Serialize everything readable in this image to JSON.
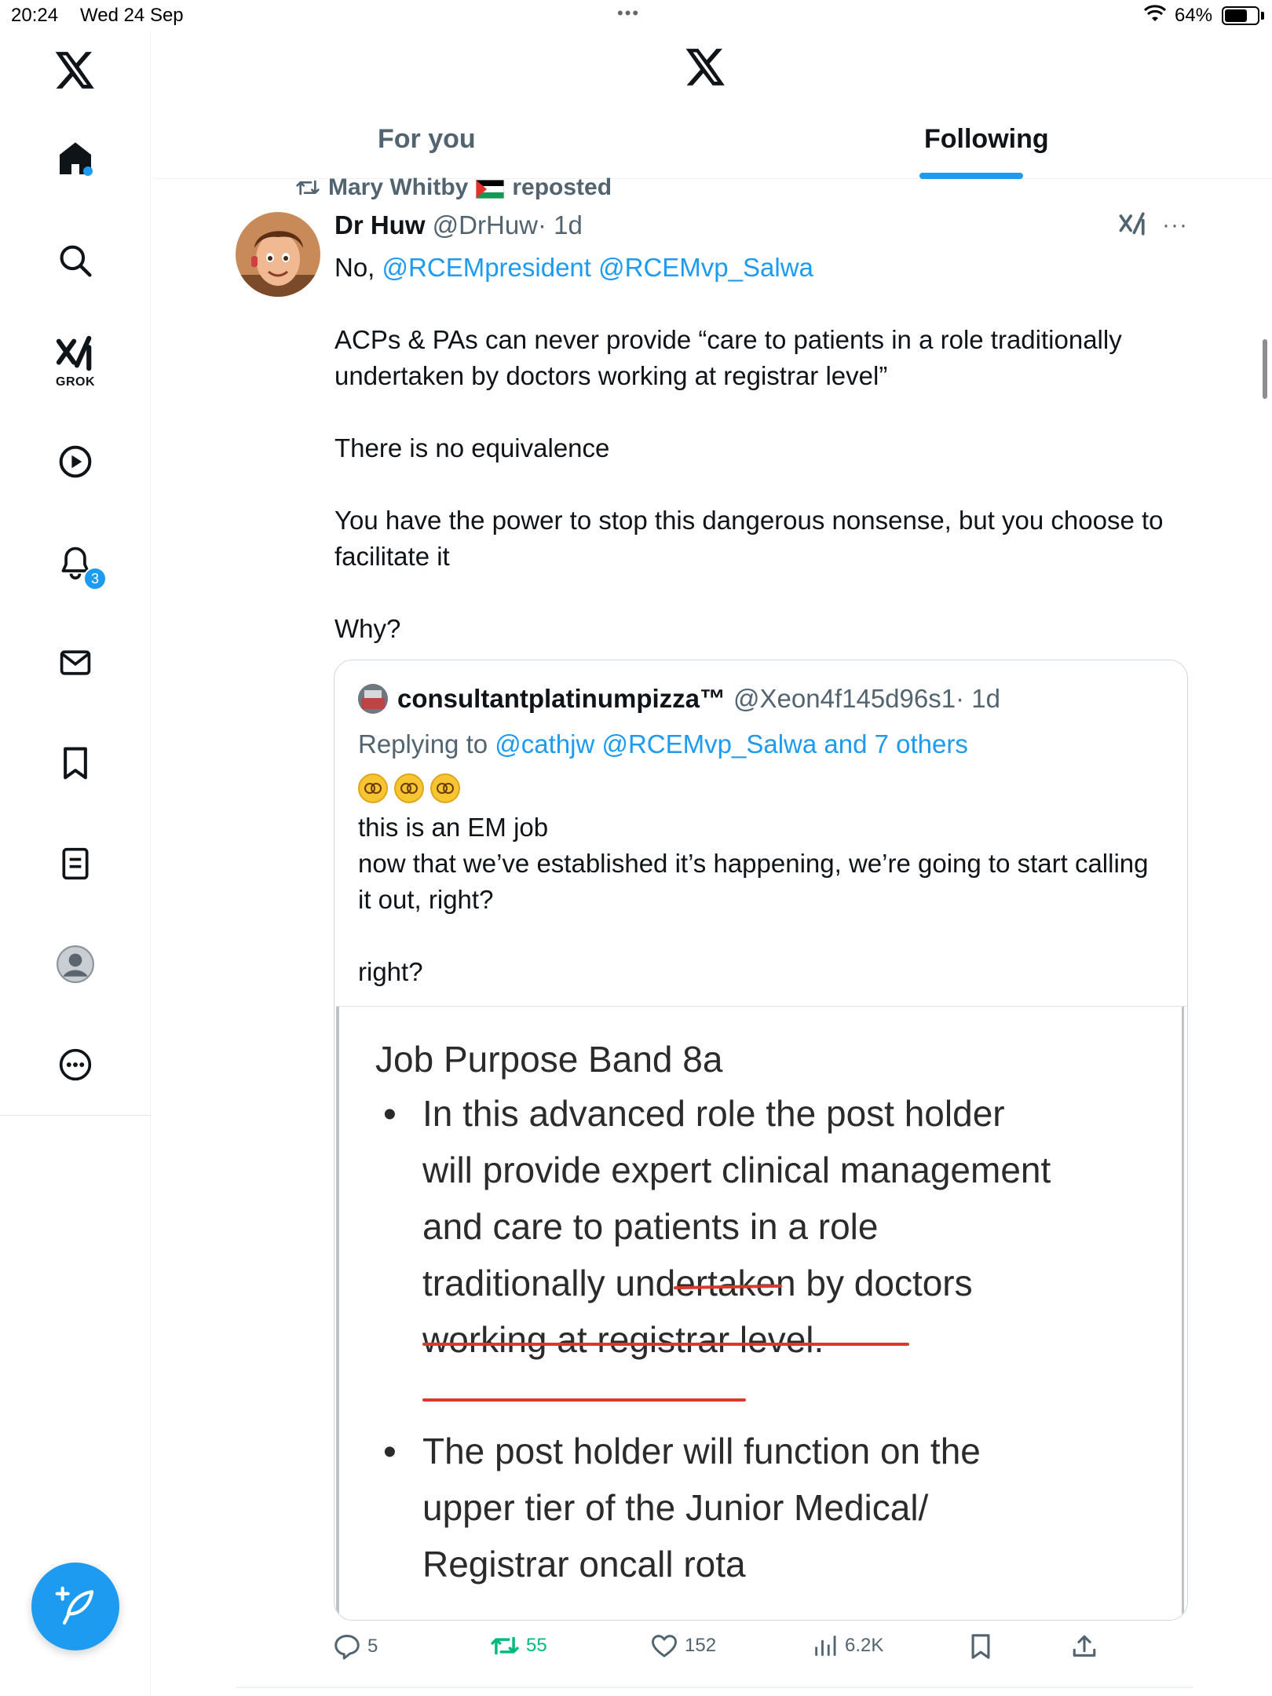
{
  "status_bar": {
    "time": "20:24",
    "date": "Wed 24 Sep",
    "battery": "64%"
  },
  "sidebar": {
    "grok_label": "GROK",
    "notifications_count": "3"
  },
  "header": {
    "tabs": [
      {
        "label": "For you",
        "active": false
      },
      {
        "label": "Following",
        "active": true
      }
    ]
  },
  "tweet": {
    "repost_label": "Mary Whitby",
    "repost_suffix": "reposted",
    "author_name": "Dr Huw",
    "author_handle": "@DrHuw",
    "time": "· 1d",
    "line1_prefix": "No, ",
    "mention1": "@RCEMpresident",
    "mention2": "@RCEMvp_Salwa",
    "para1": "ACPs & PAs can never provide “care to patients in a role traditionally undertaken by doctors working at registrar level”",
    "para2": "There is no equivalence",
    "para3": "You have the power to stop this dangerous nonsense, but you choose to facilitate it",
    "para4": "Why?",
    "stats": {
      "replies": "5",
      "reposts": "55",
      "likes": "152",
      "views": "6.2K"
    }
  },
  "quote": {
    "author_name": "consultantplatinumpizza™",
    "author_handle": "@Xeon4f145d96s1",
    "time": "· 1d",
    "replying_prefix": "Replying to ",
    "replying_mentions": "@cathjw @RCEMvp_Salwa and 7 others",
    "line1": "this is an EM job",
    "line2": "now that we’ve established it’s happening, we’re going to start calling it out, right?",
    "line3": "right?",
    "image": {
      "title": "Job Purpose Band 8a",
      "bullet1_l1": "In this advanced role the post holder",
      "bullet1_l2": "will provide expert clinical management",
      "bullet1_l3": "and care to patients in a role",
      "bullet1_l4": "traditionally undertaken by doctors",
      "bullet1_l5": "working at registrar level.",
      "bullet2_l1": "The post holder will function on the",
      "bullet2_l2": "upper tier of the Junior Medical/",
      "bullet2_l3": "Registrar oncall rota"
    }
  },
  "colors": {
    "accent": "#1d9bf0",
    "text": "#0f1419",
    "muted": "#536471",
    "repost_green": "#00ba7c",
    "underline_red": "#d93a2b"
  }
}
